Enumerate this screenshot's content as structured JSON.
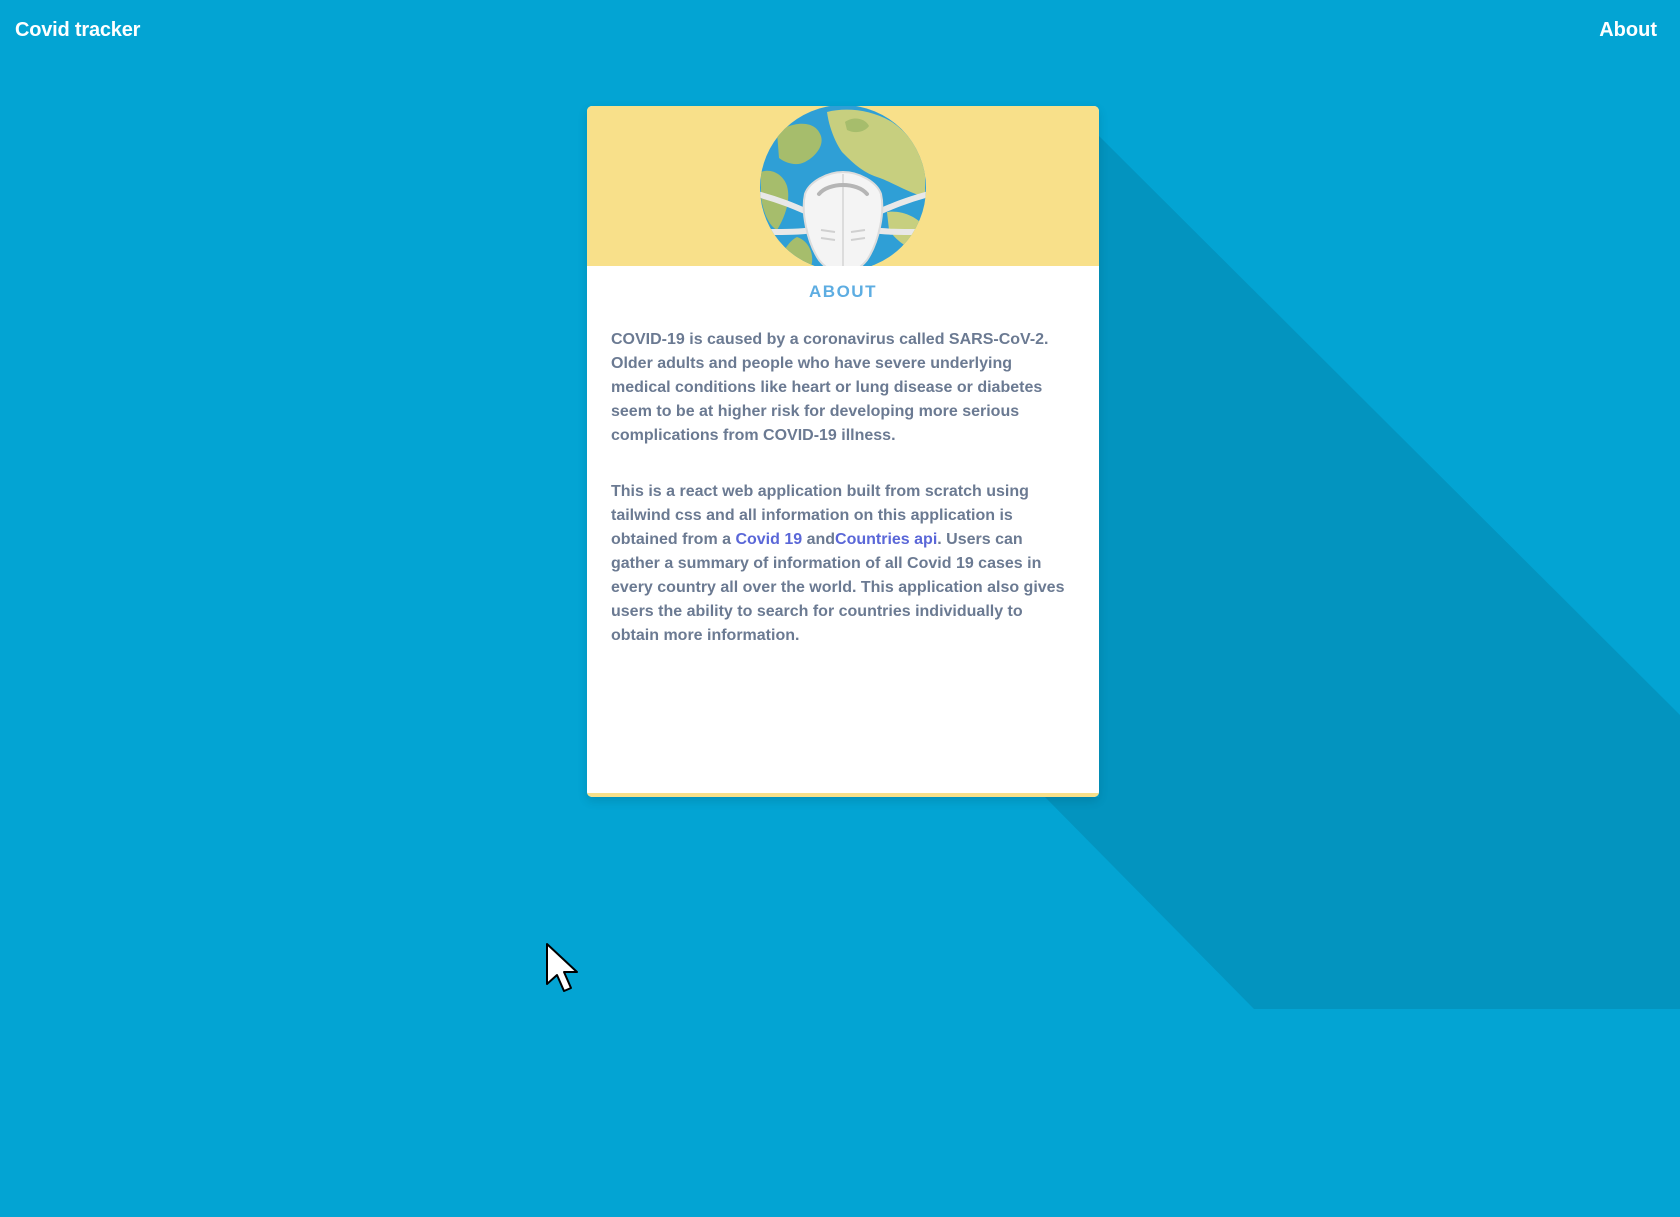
{
  "navbar": {
    "brand": "Covid tracker",
    "about_link": "About"
  },
  "card": {
    "title": "ABOUT",
    "paragraph1": "COVID-19 is caused by a coronavirus called SARS-CoV-2. Older adults and people who have severe underlying medical conditions like heart or lung disease or diabetes seem to be at higher risk for developing more serious complications from COVID-19 illness.",
    "paragraph2": {
      "before": "This is a react web application built from scratch using tailwind css and all information on this application is obtained from a ",
      "link1": "Covid 19",
      "between": " and",
      "link2": "Countries api",
      "after": ". Users can gather a summary of information of all Covid 19 cases in every country all over the world. This application also gives users the ability to search for countries individually to obtain more information."
    },
    "illustration": "globe-with-face-mask-icon"
  },
  "colors": {
    "background": "#03a4d3",
    "shadow": "#0394bf",
    "card_header": "#f8e08a",
    "title": "#5dade2",
    "body_text": "#6b7a92",
    "link": "#5a67d8"
  }
}
